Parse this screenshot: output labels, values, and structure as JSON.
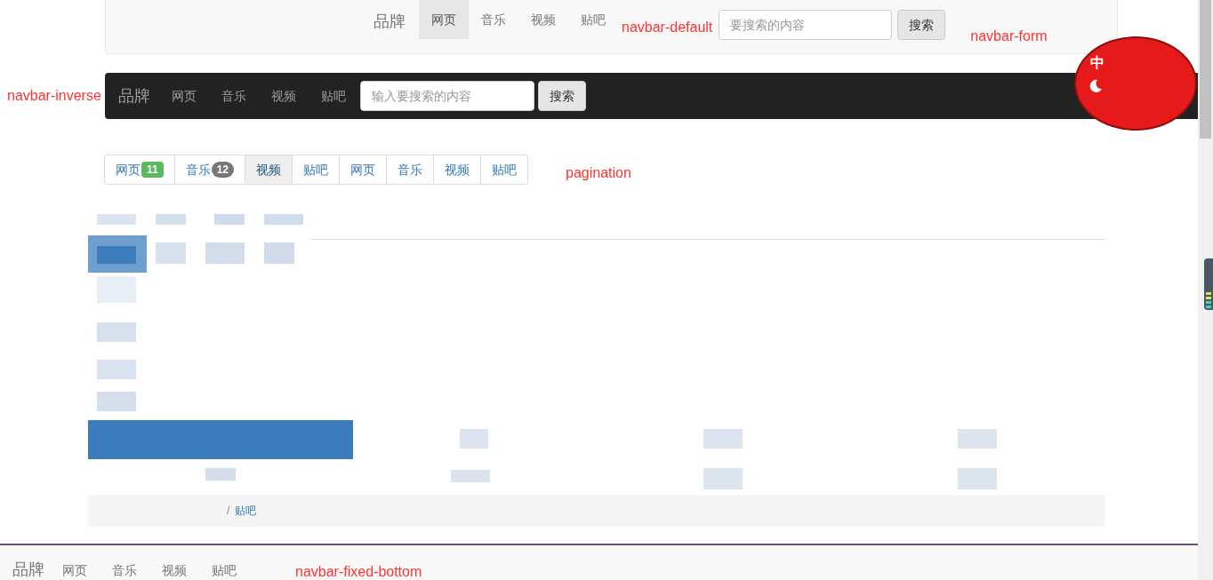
{
  "navbar_default": {
    "brand": "品牌",
    "items": [
      {
        "label": "网页",
        "selected": true
      },
      {
        "label": "音乐",
        "selected": false
      },
      {
        "label": "视频",
        "selected": false
      },
      {
        "label": "贴吧",
        "selected": false
      }
    ],
    "caption": "navbar-default",
    "search": {
      "placeholder": "要搜索的内容"
    },
    "button": "搜索",
    "form_caption": "navbar-form"
  },
  "navbar_inverse": {
    "caption": "navbar-inverse",
    "brand": "品牌",
    "items": [
      {
        "label": "网页",
        "selected": false
      },
      {
        "label": "音乐",
        "selected": false
      },
      {
        "label": "视频",
        "selected": false
      },
      {
        "label": "贴吧",
        "selected": false
      }
    ],
    "search": {
      "placeholder": "输入要搜索的内容"
    },
    "button": "搜索"
  },
  "ime_widget": {
    "glyph": "中"
  },
  "pagination": {
    "caption": "pagination",
    "items": [
      {
        "label": "网页",
        "badge": "11",
        "color": "#5cb85c",
        "selected": false
      },
      {
        "label": "音乐",
        "badge": "12",
        "color": "#777777",
        "selected": false
      },
      {
        "label": "视频",
        "selected": true
      },
      {
        "label": "贴吧",
        "selected": false
      },
      {
        "label": "网页",
        "selected": false
      },
      {
        "label": "音乐",
        "selected": false
      },
      {
        "label": "视频",
        "selected": false
      },
      {
        "label": "贴吧",
        "selected": false
      }
    ]
  },
  "breadcrumb": {
    "separator": "/",
    "last": "贴吧"
  },
  "navbar_fixed_bottom": {
    "brand": "品牌",
    "items": [
      {
        "label": "网页",
        "selected": false
      },
      {
        "label": "音乐",
        "selected": false
      },
      {
        "label": "视频",
        "selected": false
      },
      {
        "label": "贴吧",
        "selected": false
      }
    ],
    "caption": "navbar-fixed-bottom"
  }
}
